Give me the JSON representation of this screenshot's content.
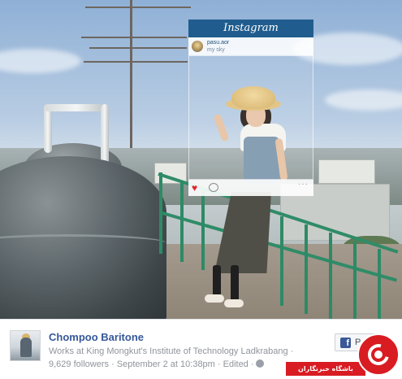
{
  "instagram": {
    "title": "Instagram",
    "username": "pasu.aor",
    "caption": "my sky",
    "heart_icon": "heart-icon",
    "comment_icon": "comment-icon",
    "more_label": "···"
  },
  "post": {
    "author_name": "Chompoo Baritone",
    "work": "Works at King Mongkut's Institute of Technology Ladkrabang ·",
    "meta": "9,629 followers · September 2 at 10:38pm · Edited ·",
    "page_button_label": "P"
  },
  "watermark": {
    "text": "باشگاه خبرنگاران"
  },
  "colors": {
    "instagram_blue": "#205d8e",
    "facebook_blue": "#365899",
    "railing_green": "#2f8c68",
    "watermark_red": "#d81c22"
  }
}
